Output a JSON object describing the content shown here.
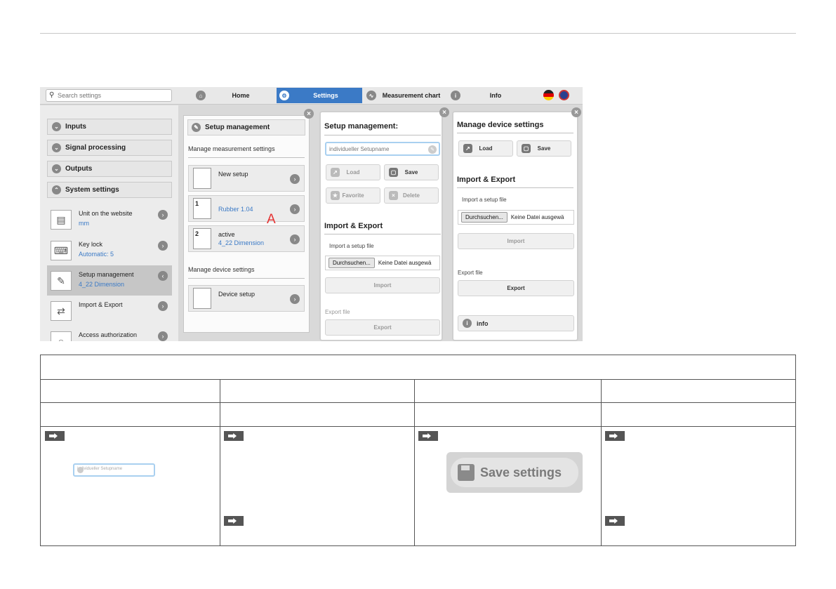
{
  "search": {
    "placeholder": "Search settings"
  },
  "nav": {
    "home": "Home",
    "settings": "Settings",
    "measurement_chart": "Measurement chart",
    "info": "Info"
  },
  "sidebar": {
    "sections": [
      "Inputs",
      "Signal processing",
      "Outputs",
      "System settings"
    ],
    "items": [
      {
        "label": "Unit on the website",
        "value": "mm"
      },
      {
        "label": "Key lock",
        "value": "Automatic: 5"
      },
      {
        "label": "Setup management",
        "value": "4_22 Dimension"
      },
      {
        "label": "Import & Export",
        "value": ""
      },
      {
        "label": "Access authorization",
        "value": ""
      }
    ]
  },
  "setup_panel": {
    "title": "Setup management",
    "measurement_heading": "Manage measurement settings",
    "setups": [
      {
        "label": "New setup",
        "value": "",
        "num": ""
      },
      {
        "label": "",
        "value": "Rubber 1.04",
        "num": "1"
      },
      {
        "label": "active",
        "value": "4_22 Dimension",
        "num": "2"
      }
    ],
    "device_heading": "Manage device settings",
    "device_setup": "Device setup"
  },
  "marker_a": "A",
  "dialog_setup": {
    "title": "Setup management:",
    "name_placeholder": "individueller Setupname",
    "load": "Load",
    "save": "Save",
    "favorite": "Favorite",
    "delete": "Delete",
    "import_export": "Import & Export",
    "import_file": "Import a setup file",
    "browse": "Durchsuchen...",
    "no_file": "Keine Datei ausgewä",
    "import": "Import",
    "export_file": "Export file",
    "export": "Export"
  },
  "dialog_device": {
    "title": "Manage device settings",
    "load": "Load",
    "save": "Save",
    "import_export": "Import & Export",
    "import_file": "Import a setup file",
    "browse": "Durchsuchen...",
    "no_file": "Keine Datei ausgewä",
    "import": "Import",
    "export_file": "Export file",
    "export": "Export",
    "info": "info"
  },
  "table": {
    "field_placeholder": "individueller Setupname",
    "save_settings": "Save settings"
  },
  "colors": {
    "accent": "#3b7ac6",
    "marker": "#e53232",
    "field_border": "#a9d0f0"
  }
}
